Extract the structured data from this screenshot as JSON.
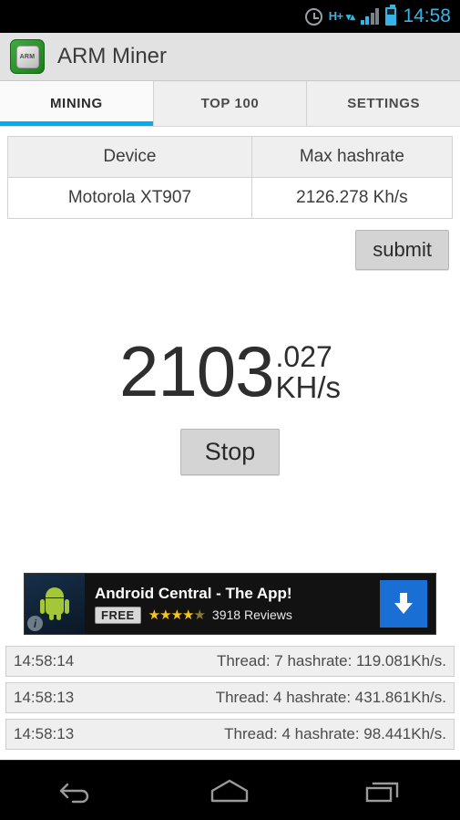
{
  "status_bar": {
    "alarm_icon": "alarm-clock-icon",
    "network_label": "H+",
    "network_arrows": "▾▴",
    "signal_icon": "signal-bars-icon",
    "battery_icon": "battery-icon",
    "time": "14:58",
    "accent_color": "#33b5e5"
  },
  "action_bar": {
    "app_icon": "arm-chip-icon",
    "app_icon_label": "ARM",
    "title": "ARM Miner",
    "background": "#e2e2e2"
  },
  "tabs": {
    "active_index": 0,
    "indicator_color": "#00aeef",
    "items": [
      {
        "label": "MINING"
      },
      {
        "label": "TOP 100"
      },
      {
        "label": "SETTINGS"
      }
    ]
  },
  "device_table": {
    "headers": [
      "Device",
      "Max hashrate"
    ],
    "rows": [
      {
        "device": "Motorola XT907",
        "max_hashrate": "2126.278 Kh/s"
      }
    ]
  },
  "submit_button": {
    "label": "submit"
  },
  "hashrate_display": {
    "integer": "2103",
    "decimal": ".027",
    "unit": "KH/s"
  },
  "control_button": {
    "label": "Stop"
  },
  "ad_banner": {
    "info_badge": "i",
    "thumbnail_icon": "android-robot-icon",
    "title": "Android Central - The App!",
    "price_badge": "FREE",
    "stars_full": "★★★★",
    "stars_half": "★",
    "reviews": "3918 Reviews",
    "download_icon": "download-arrow-icon",
    "download_color": "#1a6fd4"
  },
  "log_list": [
    {
      "time": "14:58:14",
      "message": "Thread: 7 hashrate: 119.081Kh/s."
    },
    {
      "time": "14:58:13",
      "message": "Thread: 4 hashrate: 431.861Kh/s."
    },
    {
      "time": "14:58:13",
      "message": "Thread: 4 hashrate: 98.441Kh/s."
    }
  ],
  "nav_bar": {
    "back": "back-icon",
    "home": "home-icon",
    "recents": "recents-icon"
  }
}
